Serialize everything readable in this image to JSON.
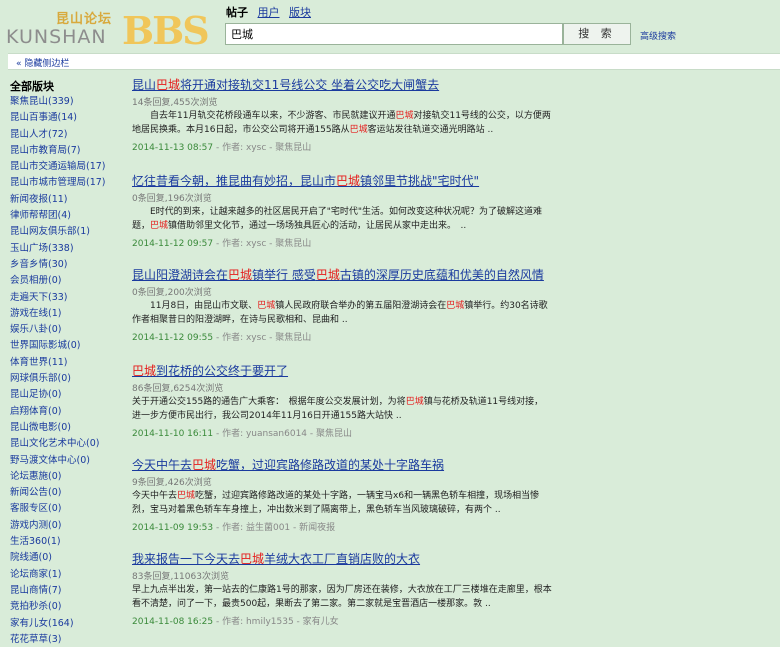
{
  "logo": {
    "cn": "昆山论坛",
    "en": "KUNSHAN",
    "bbs": "BBS"
  },
  "search": {
    "tabs": [
      {
        "label": "帖子",
        "active": true
      },
      {
        "label": "用户",
        "active": false
      },
      {
        "label": "版块",
        "active": false
      }
    ],
    "query": "巴城",
    "button_label": "搜 索",
    "advanced_label": "高级搜索"
  },
  "hide_sidebar_label": "« 隐藏侧边栏",
  "sidebar": {
    "heading": "全部版块",
    "items": [
      "聚焦昆山(339)",
      "昆山百事通(14)",
      "昆山人才(72)",
      "昆山市教育局(7)",
      "昆山市交通运输局(17)",
      "昆山市城市管理局(17)",
      "新闻夜报(11)",
      "律师帮帮团(4)",
      "昆山网友俱乐部(1)",
      "玉山广场(338)",
      "乡音乡情(30)",
      "会员相册(0)",
      "走遍天下(33)",
      "游戏在线(1)",
      "娱乐八卦(0)",
      "世界国际影城(0)",
      "体育世界(11)",
      "网球俱乐部(0)",
      "昆山足协(0)",
      "启翔体育(0)",
      "昆山微电影(0)",
      "昆山文化艺术中心(0)",
      "野马渡文体中心(0)",
      "论坛惠施(0)",
      "新闻公告(0)",
      "客服专区(0)",
      "游戏内测(0)",
      "生活360(1)",
      "院线通(0)",
      "论坛商家(1)",
      "昆山商情(7)",
      "竞拍秒杀(0)",
      "家有儿女(164)",
      "花花草草(3)"
    ]
  },
  "results": [
    {
      "title": [
        "昆山",
        "巴城",
        "将开通对接轨交11号线公交 坐着公交吃大闸蟹去"
      ],
      "stats": "14条回复,455次浏览",
      "snippet": [
        "　　自去年11月轨交花桥段通车以来，不少游客、市民就建议开通",
        "巴城",
        "对接轨交11号线的公交，以方便两地居民换乘。本月16日起，市公交公司将开通155路从",
        "巴城",
        "客运站发往轨道交通光明路站 .."
      ],
      "date": "2014-11-13 08:57",
      "meta": " - 作者: xysc - 聚焦昆山"
    },
    {
      "title": [
        "忆往昔看今朝，推昆曲有妙招，昆山市",
        "巴城",
        "镇邻里节挑战\"宅时代\""
      ],
      "stats": "0条回复,196次浏览",
      "snippet": [
        "　　E时代的到来，让越来越多的社区居民开启了\"宅时代\"生活。如何改变这种状况呢？为了破解这道难题，",
        "巴城",
        "镇借助邻里文化节，通过一场场独具匠心的活动，让居民从家中走出来。　.."
      ],
      "date": "2014-11-12 09:57",
      "meta": " - 作者: xysc - 聚焦昆山"
    },
    {
      "title": [
        "昆山阳澄湖诗会在",
        "巴城",
        "镇举行 感受",
        "巴城",
        "古镇的深厚历史底蕴和优美的自然风情"
      ],
      "stats": "0条回复,200次浏览",
      "snippet": [
        "　　11月8日，由昆山市文联、",
        "巴城",
        "镇人民政府联合举办的第五届阳澄湖诗会在",
        "巴城",
        "镇举行。约30名诗歌作者相聚昔日的阳澄湖畔，在诗与民歌相和、昆曲和 .."
      ],
      "date": "2014-11-12 09:55",
      "meta": " - 作者: xysc - 聚焦昆山"
    },
    {
      "title": [
        "",
        "巴城",
        "到花桥的公交终于要开了"
      ],
      "stats": "86条回复,6254次浏览",
      "snippet": [
        "关于开通公交155路的通告广大乘客：　根据年度公交发展计划，为将",
        "巴城",
        "镇与花桥及轨道11号线对接，进一步方便市民出行，我公司2014年11月16日开通155路大站快 .."
      ],
      "date": "2014-11-10 16:11",
      "meta": " - 作者: yuansan6014 - 聚焦昆山"
    },
    {
      "title": [
        "今天中午去",
        "巴城",
        "吃蟹，过迎宾路修路改道的某处十字路车祸"
      ],
      "stats": "9条回复,426次浏览",
      "snippet": [
        "今天中午去",
        "巴城",
        "吃蟹，过迎宾路修路改道的某处十字路，一辆宝马x6和一辆黑色轿车相撞，现场相当惨烈，宝马对着黑色轿车车身撞上，冲出数米到了隔离带上，黑色轿车当风玻璃破碎，有两个 .."
      ],
      "date": "2014-11-09 19:53",
      "meta": " - 作者: 益生菌001 - 新闻夜报"
    },
    {
      "title": [
        "我来报告一下今天去",
        "巴城",
        "羊绒大衣工厂直销店败的大衣"
      ],
      "stats": "83条回复,11063次浏览",
      "snippet": [
        "早上九点半出发，第一站去的仁康路1号的那家，因为厂房还在装修，大衣放在工厂三楼堆在走廊里，根本看不清楚，问了一下，最贵500起，果断去了第二家。第二家就是宝晋酒店一楼那家。敦 .."
      ],
      "date": "2014-11-08 16:25",
      "meta": " - 作者: hmily1535 - 家有儿女"
    }
  ]
}
